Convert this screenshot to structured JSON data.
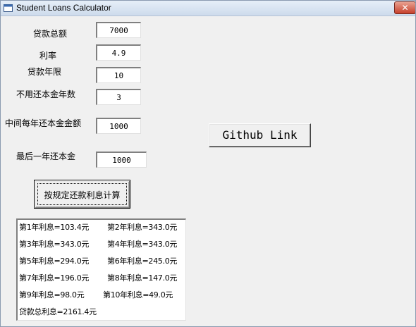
{
  "window": {
    "title": "Student Loans Calculator",
    "close_glyph": "✕"
  },
  "form": {
    "loan_amount_label": "贷款总额",
    "loan_amount_value": "7000",
    "rate_label": "利率",
    "rate_value": "4.9",
    "term_label": "贷款年限",
    "term_value": "10",
    "grace_label": "不用还本金年数",
    "grace_value": "3",
    "mid_payment_label": "中间每年还本金金额",
    "mid_payment_value": "1000",
    "final_payment_label": "最后一年还本金",
    "final_payment_value": "1000"
  },
  "buttons": {
    "calculate": "按规定还款利息计算",
    "github": "Github Link"
  },
  "results": {
    "rows": [
      [
        "第1年利息=103.4元",
        "第2年利息=343.0元"
      ],
      [
        "第3年利息=343.0元",
        "第4年利息=343.0元"
      ],
      [
        "第5年利息=294.0元",
        "第6年利息=245.0元"
      ],
      [
        "第7年利息=196.0元",
        "第8年利息=147.0元"
      ],
      [
        "第9年利息=98.0元",
        "第10年利息=49.0元"
      ]
    ],
    "total": "贷款总利息=2161.4元"
  },
  "colors": {
    "window_bg": "#f0f0f0",
    "close_button": "#c7402c"
  },
  "icons": {
    "app_icon": "window-icon",
    "close_icon": "close-icon"
  }
}
